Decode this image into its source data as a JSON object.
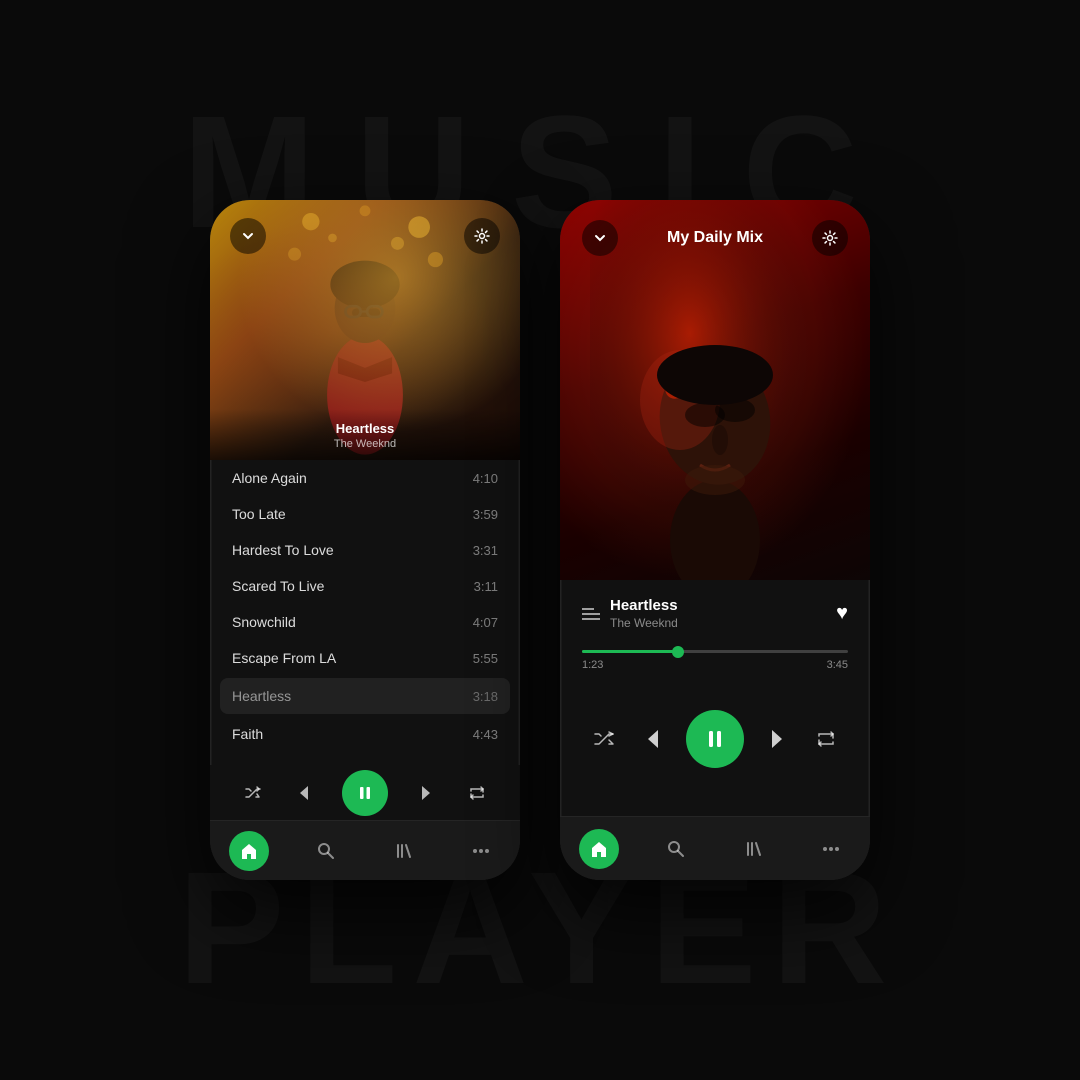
{
  "background": {
    "text_top": "MUSIC",
    "text_bottom": "PLAYER"
  },
  "phone1": {
    "album_art": {
      "song_title": "Heartless",
      "artist": "The Weeknd"
    },
    "playlist": [
      {
        "title": "Alone Again",
        "duration": "4:10"
      },
      {
        "title": "Too Late",
        "duration": "3:59"
      },
      {
        "title": "Hardest To Love",
        "duration": "3:31"
      },
      {
        "title": "Scared To Live",
        "duration": "3:11"
      },
      {
        "title": "Snowchild",
        "duration": "4:07"
      },
      {
        "title": "Escape From LA",
        "duration": "5:55"
      },
      {
        "title": "Heartless",
        "duration": "3:18",
        "active": true
      },
      {
        "title": "Faith",
        "duration": "4:43"
      }
    ],
    "controls": {
      "shuffle": "⇌",
      "prev": "⏮",
      "pause": "⏸",
      "next": "⏭",
      "repeat": "↺"
    },
    "nav": {
      "home_label": "home",
      "search_label": "search",
      "library_label": "library",
      "more_label": "more"
    }
  },
  "phone2": {
    "header": {
      "title": "My Daily Mix",
      "back_label": "chevron-down",
      "settings_label": "settings"
    },
    "now_playing": {
      "song_title": "Heartless",
      "artist": "The Weeknd",
      "liked": true
    },
    "progress": {
      "current": "1:23",
      "total": "3:45",
      "percent": 36
    },
    "controls": {
      "shuffle": "shuffle",
      "prev": "prev",
      "pause": "pause",
      "next": "next",
      "repeat": "repeat"
    },
    "nav": {
      "home_label": "home",
      "search_label": "search",
      "library_label": "library",
      "more_label": "more"
    }
  }
}
